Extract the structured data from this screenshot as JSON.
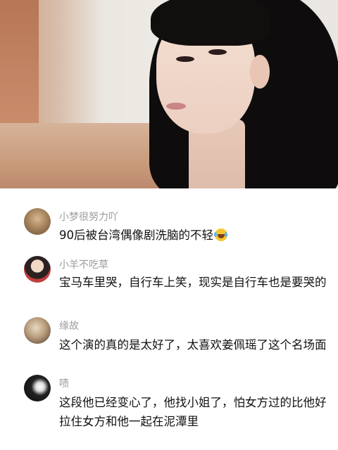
{
  "comments": [
    {
      "username": "小梦很努力吖",
      "text": "90后被台湾偶像剧洗脑的不轻",
      "emoji": "crying-laughing-emoji"
    },
    {
      "username": "小羊不吃草",
      "text": "宝马车里哭，自行车上笑，现实是自行车也是要哭的"
    },
    {
      "username": "缘故",
      "text": "这个演的真的是太好了，太喜欢姜佩瑶了这个名场面"
    },
    {
      "username": "啧",
      "text": "这段他已经变心了，他找小姐了，怕女方过的比他好拉住女方和他一起在泥潭里"
    }
  ]
}
